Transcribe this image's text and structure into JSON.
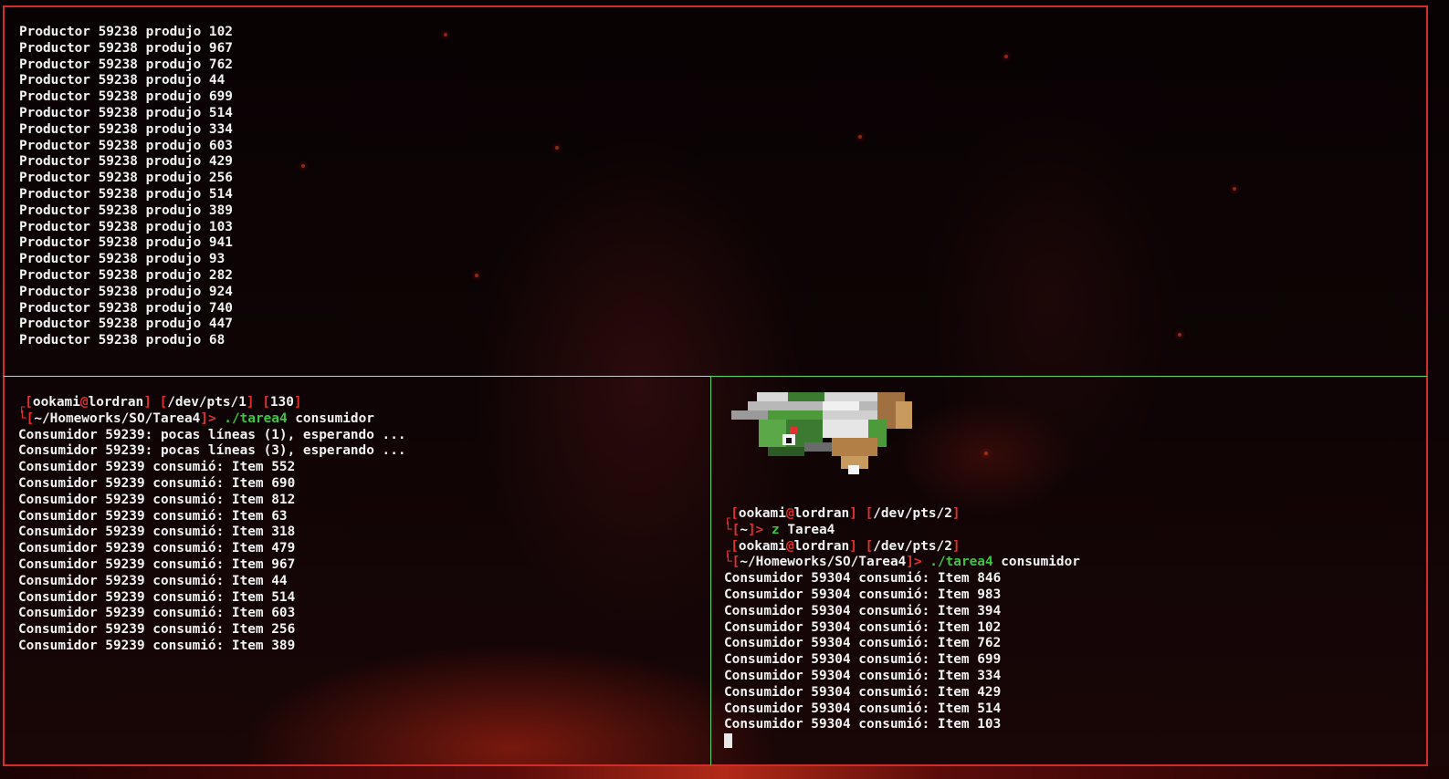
{
  "top_pane": {
    "lines": [
      "Productor 59238 produjo 102",
      "Productor 59238 produjo 967",
      "Productor 59238 produjo 762",
      "Productor 59238 produjo 44",
      "Productor 59238 produjo 699",
      "Productor 59238 produjo 514",
      "Productor 59238 produjo 334",
      "Productor 59238 produjo 603",
      "Productor 59238 produjo 429",
      "Productor 59238 produjo 256",
      "Productor 59238 produjo 514",
      "Productor 59238 produjo 389",
      "Productor 59238 produjo 103",
      "Productor 59238 produjo 941",
      "Productor 59238 produjo 93",
      "Productor 59238 produjo 282",
      "Productor 59238 produjo 924",
      "Productor 59238 produjo 740",
      "Productor 59238 produjo 447",
      "Productor 59238 produjo 68"
    ]
  },
  "bottom_left_pane": {
    "prompt": {
      "user": "ookami",
      "at": "@",
      "host": "lordran",
      "tty": "/dev/pts/1",
      "exit_code": "130",
      "cwd": "~/Homeworks/SO/Tarea4",
      "arrow": ">",
      "command": "./tarea4",
      "args": " consumidor"
    },
    "lines": [
      "Consumidor 59239: pocas líneas (1), esperando ...",
      "Consumidor 59239: pocas líneas (3), esperando ...",
      "Consumidor 59239 consumió: Item 552",
      "Consumidor 59239 consumió: Item 690",
      "Consumidor 59239 consumió: Item 812",
      "Consumidor 59239 consumió: Item 63",
      "Consumidor 59239 consumió: Item 318",
      "Consumidor 59239 consumió: Item 479",
      "Consumidor 59239 consumió: Item 967",
      "Consumidor 59239 consumió: Item 44",
      "Consumidor 59239 consumió: Item 514",
      "Consumidor 59239 consumió: Item 603",
      "Consumidor 59239 consumió: Item 256",
      "Consumidor 59239 consumió: Item 389"
    ]
  },
  "bottom_right_pane": {
    "prompt1": {
      "user": "ookami",
      "at": "@",
      "host": "lordran",
      "tty": "/dev/pts/2",
      "cwd": "~",
      "arrow": ">",
      "command": "z",
      "args": " Tarea4"
    },
    "prompt2": {
      "user": "ookami",
      "at": "@",
      "host": "lordran",
      "tty": "/dev/pts/2",
      "cwd": "~/Homeworks/SO/Tarea4",
      "arrow": ">",
      "command": "./tarea4",
      "args": " consumidor"
    },
    "lines": [
      "Consumidor 59304 consumió: Item 846",
      "Consumidor 59304 consumió: Item 983",
      "Consumidor 59304 consumió: Item 394",
      "Consumidor 59304 consumió: Item 102",
      "Consumidor 59304 consumió: Item 762",
      "Consumidor 59304 consumió: Item 699",
      "Consumidor 59304 consumió: Item 334",
      "Consumidor 59304 consumió: Item 429",
      "Consumidor 59304 consumió: Item 514",
      "Consumidor 59304 consumió: Item 103"
    ],
    "pixel_art_icon": "pokemon-sprite-icon"
  },
  "colors": {
    "active_border": "#5ad65a",
    "inactive_border": "#d42b2b",
    "prompt_bracket": "#e03030",
    "command": "#3ec43e",
    "text": "#f2f2f2"
  }
}
